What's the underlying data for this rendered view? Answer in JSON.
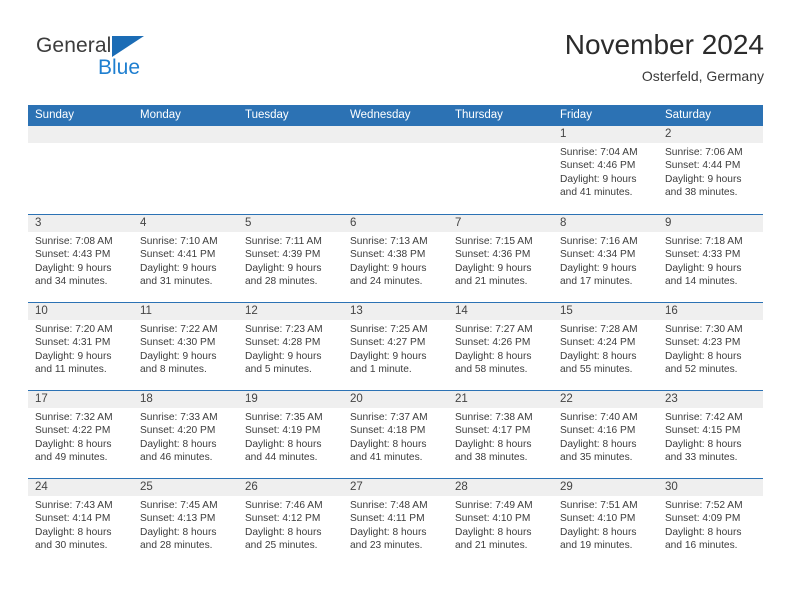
{
  "brand": {
    "name_part1": "General",
    "name_part2": "Blue",
    "triangle_color": "#1b6cb5",
    "blue_text_color": "#1f7fd0"
  },
  "header": {
    "title": "November 2024",
    "location": "Osterfeld, Germany"
  },
  "theme": {
    "header_blue": "#2c72b4",
    "date_strip_gray": "#efefef",
    "text_color": "#3d3d3d"
  },
  "weekdays": [
    "Sunday",
    "Monday",
    "Tuesday",
    "Wednesday",
    "Thursday",
    "Friday",
    "Saturday"
  ],
  "weeks": [
    [
      {
        "day": "",
        "sunrise": "",
        "sunset": "",
        "daylight": ""
      },
      {
        "day": "",
        "sunrise": "",
        "sunset": "",
        "daylight": ""
      },
      {
        "day": "",
        "sunrise": "",
        "sunset": "",
        "daylight": ""
      },
      {
        "day": "",
        "sunrise": "",
        "sunset": "",
        "daylight": ""
      },
      {
        "day": "",
        "sunrise": "",
        "sunset": "",
        "daylight": ""
      },
      {
        "day": "1",
        "sunrise": "Sunrise: 7:04 AM",
        "sunset": "Sunset: 4:46 PM",
        "daylight": "Daylight: 9 hours and 41 minutes."
      },
      {
        "day": "2",
        "sunrise": "Sunrise: 7:06 AM",
        "sunset": "Sunset: 4:44 PM",
        "daylight": "Daylight: 9 hours and 38 minutes."
      }
    ],
    [
      {
        "day": "3",
        "sunrise": "Sunrise: 7:08 AM",
        "sunset": "Sunset: 4:43 PM",
        "daylight": "Daylight: 9 hours and 34 minutes."
      },
      {
        "day": "4",
        "sunrise": "Sunrise: 7:10 AM",
        "sunset": "Sunset: 4:41 PM",
        "daylight": "Daylight: 9 hours and 31 minutes."
      },
      {
        "day": "5",
        "sunrise": "Sunrise: 7:11 AM",
        "sunset": "Sunset: 4:39 PM",
        "daylight": "Daylight: 9 hours and 28 minutes."
      },
      {
        "day": "6",
        "sunrise": "Sunrise: 7:13 AM",
        "sunset": "Sunset: 4:38 PM",
        "daylight": "Daylight: 9 hours and 24 minutes."
      },
      {
        "day": "7",
        "sunrise": "Sunrise: 7:15 AM",
        "sunset": "Sunset: 4:36 PM",
        "daylight": "Daylight: 9 hours and 21 minutes."
      },
      {
        "day": "8",
        "sunrise": "Sunrise: 7:16 AM",
        "sunset": "Sunset: 4:34 PM",
        "daylight": "Daylight: 9 hours and 17 minutes."
      },
      {
        "day": "9",
        "sunrise": "Sunrise: 7:18 AM",
        "sunset": "Sunset: 4:33 PM",
        "daylight": "Daylight: 9 hours and 14 minutes."
      }
    ],
    [
      {
        "day": "10",
        "sunrise": "Sunrise: 7:20 AM",
        "sunset": "Sunset: 4:31 PM",
        "daylight": "Daylight: 9 hours and 11 minutes."
      },
      {
        "day": "11",
        "sunrise": "Sunrise: 7:22 AM",
        "sunset": "Sunset: 4:30 PM",
        "daylight": "Daylight: 9 hours and 8 minutes."
      },
      {
        "day": "12",
        "sunrise": "Sunrise: 7:23 AM",
        "sunset": "Sunset: 4:28 PM",
        "daylight": "Daylight: 9 hours and 5 minutes."
      },
      {
        "day": "13",
        "sunrise": "Sunrise: 7:25 AM",
        "sunset": "Sunset: 4:27 PM",
        "daylight": "Daylight: 9 hours and 1 minute."
      },
      {
        "day": "14",
        "sunrise": "Sunrise: 7:27 AM",
        "sunset": "Sunset: 4:26 PM",
        "daylight": "Daylight: 8 hours and 58 minutes."
      },
      {
        "day": "15",
        "sunrise": "Sunrise: 7:28 AM",
        "sunset": "Sunset: 4:24 PM",
        "daylight": "Daylight: 8 hours and 55 minutes."
      },
      {
        "day": "16",
        "sunrise": "Sunrise: 7:30 AM",
        "sunset": "Sunset: 4:23 PM",
        "daylight": "Daylight: 8 hours and 52 minutes."
      }
    ],
    [
      {
        "day": "17",
        "sunrise": "Sunrise: 7:32 AM",
        "sunset": "Sunset: 4:22 PM",
        "daylight": "Daylight: 8 hours and 49 minutes."
      },
      {
        "day": "18",
        "sunrise": "Sunrise: 7:33 AM",
        "sunset": "Sunset: 4:20 PM",
        "daylight": "Daylight: 8 hours and 46 minutes."
      },
      {
        "day": "19",
        "sunrise": "Sunrise: 7:35 AM",
        "sunset": "Sunset: 4:19 PM",
        "daylight": "Daylight: 8 hours and 44 minutes."
      },
      {
        "day": "20",
        "sunrise": "Sunrise: 7:37 AM",
        "sunset": "Sunset: 4:18 PM",
        "daylight": "Daylight: 8 hours and 41 minutes."
      },
      {
        "day": "21",
        "sunrise": "Sunrise: 7:38 AM",
        "sunset": "Sunset: 4:17 PM",
        "daylight": "Daylight: 8 hours and 38 minutes."
      },
      {
        "day": "22",
        "sunrise": "Sunrise: 7:40 AM",
        "sunset": "Sunset: 4:16 PM",
        "daylight": "Daylight: 8 hours and 35 minutes."
      },
      {
        "day": "23",
        "sunrise": "Sunrise: 7:42 AM",
        "sunset": "Sunset: 4:15 PM",
        "daylight": "Daylight: 8 hours and 33 minutes."
      }
    ],
    [
      {
        "day": "24",
        "sunrise": "Sunrise: 7:43 AM",
        "sunset": "Sunset: 4:14 PM",
        "daylight": "Daylight: 8 hours and 30 minutes."
      },
      {
        "day": "25",
        "sunrise": "Sunrise: 7:45 AM",
        "sunset": "Sunset: 4:13 PM",
        "daylight": "Daylight: 8 hours and 28 minutes."
      },
      {
        "day": "26",
        "sunrise": "Sunrise: 7:46 AM",
        "sunset": "Sunset: 4:12 PM",
        "daylight": "Daylight: 8 hours and 25 minutes."
      },
      {
        "day": "27",
        "sunrise": "Sunrise: 7:48 AM",
        "sunset": "Sunset: 4:11 PM",
        "daylight": "Daylight: 8 hours and 23 minutes."
      },
      {
        "day": "28",
        "sunrise": "Sunrise: 7:49 AM",
        "sunset": "Sunset: 4:10 PM",
        "daylight": "Daylight: 8 hours and 21 minutes."
      },
      {
        "day": "29",
        "sunrise": "Sunrise: 7:51 AM",
        "sunset": "Sunset: 4:10 PM",
        "daylight": "Daylight: 8 hours and 19 minutes."
      },
      {
        "day": "30",
        "sunrise": "Sunrise: 7:52 AM",
        "sunset": "Sunset: 4:09 PM",
        "daylight": "Daylight: 8 hours and 16 minutes."
      }
    ]
  ]
}
